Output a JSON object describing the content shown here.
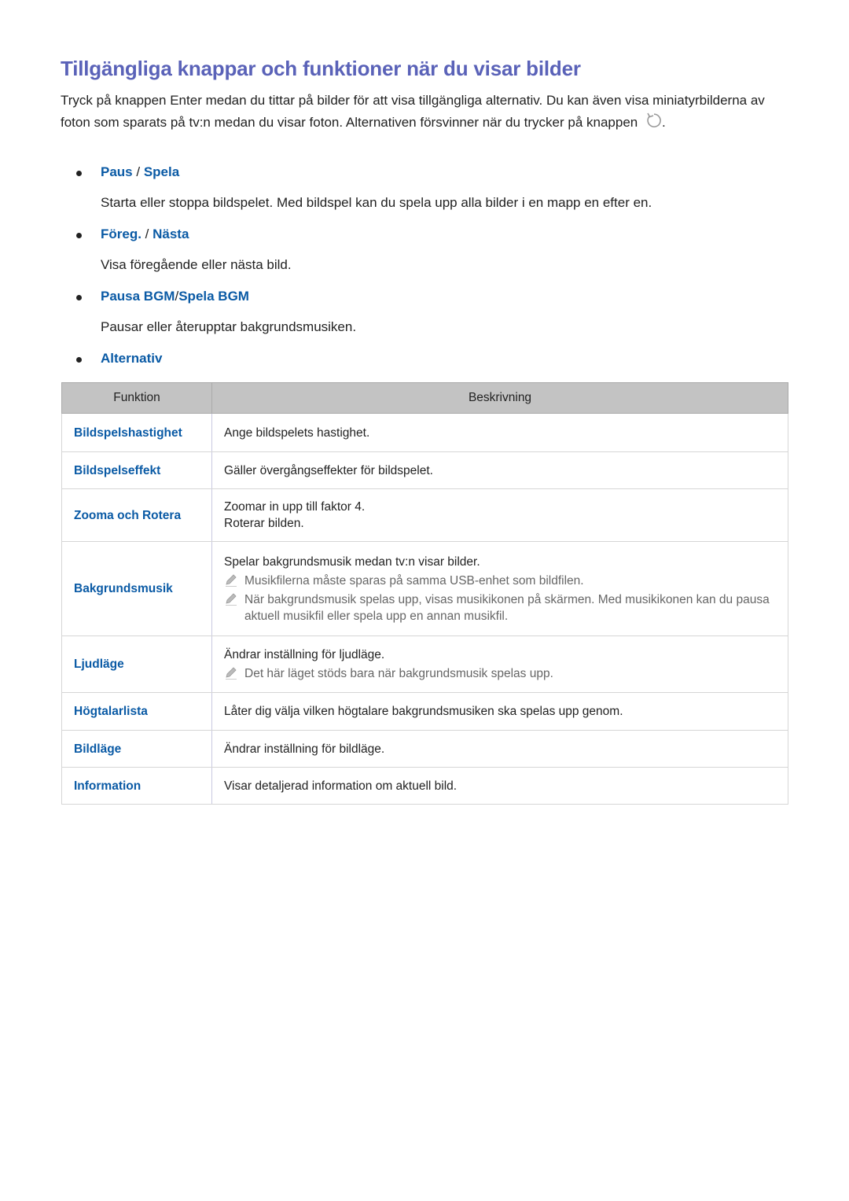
{
  "title": "Tillgängliga knappar och funktioner när du visar bilder",
  "intro": "Tryck på knappen Enter medan du tittar på bilder för att visa tillgängliga alternativ. Du kan även visa miniatyrbilderna av foton som sparats på tv:n medan du visar foton. Alternativen försvinner när du trycker på knappen",
  "intro_end": ".",
  "bullets": [
    {
      "a": "Paus",
      "sep": " / ",
      "b": "Spela",
      "desc": "Starta eller stoppa bildspelet. Med bildspel kan du spela upp alla bilder i en mapp en efter en."
    },
    {
      "a": "Föreg.",
      "sep": " / ",
      "b": "Nästa",
      "desc": "Visa föregående eller nästa bild."
    },
    {
      "a": "Pausa BGM",
      "sep": "/",
      "b": "Spela BGM",
      "desc": "Pausar eller återupptar bakgrundsmusiken."
    },
    {
      "a": "Alternativ"
    }
  ],
  "table": {
    "headers": [
      "Funktion",
      "Beskrivning"
    ],
    "rows": [
      {
        "f": "Bildspelshastighet",
        "d": [
          "Ange bildspelets hastighet."
        ]
      },
      {
        "f": "Bildspelseffekt",
        "d": [
          "Gäller övergångseffekter för bildspelet."
        ]
      },
      {
        "f": "Zooma och Rotera",
        "d": [
          "Zoomar in upp till faktor 4.",
          "Roterar bilden."
        ]
      },
      {
        "f": "Bakgrundsmusik",
        "d": [
          "Spelar bakgrundsmusik medan tv:n visar bilder."
        ],
        "notes": [
          "Musikfilerna måste sparas på samma USB-enhet som bildfilen.",
          "När bakgrundsmusik spelas upp, visas musikikonen på skärmen. Med musikikonen kan du pausa aktuell musikfil eller spela upp en annan musikfil."
        ]
      },
      {
        "f": "Ljudläge",
        "d": [
          "Ändrar inställning för ljudläge."
        ],
        "notes": [
          "Det här läget stöds bara när bakgrundsmusik spelas upp."
        ]
      },
      {
        "f": "Högtalarlista",
        "d": [
          "Låter dig välja vilken högtalare bakgrundsmusiken ska spelas upp genom."
        ]
      },
      {
        "f": "Bildläge",
        "d": [
          "Ändrar inställning för bildläge."
        ]
      },
      {
        "f": "Information",
        "d": [
          "Visar detaljerad information om aktuell bild."
        ]
      }
    ]
  },
  "colors": {
    "title": "#5a62b8",
    "link": "#0a5aa5",
    "header_bg": "#c3c3c3"
  },
  "icons": {
    "back": "return-arrow-icon",
    "note": "pencil-icon"
  }
}
